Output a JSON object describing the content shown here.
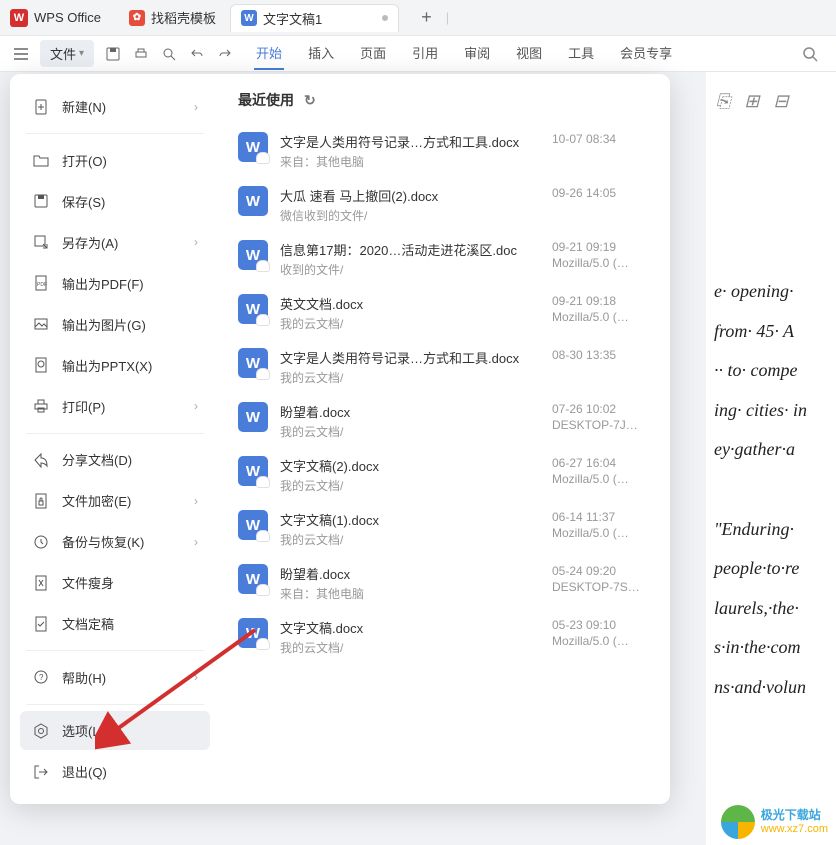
{
  "title_bar": {
    "app_name": "WPS Office",
    "template_tab": "找稻壳模板",
    "doc_tab": "文字文稿1",
    "add": "+",
    "divider": "|"
  },
  "menu_bar": {
    "file_label": "文件",
    "tabs": [
      "开始",
      "插入",
      "页面",
      "引用",
      "审阅",
      "视图",
      "工具",
      "会员专享"
    ],
    "active_index": 0
  },
  "dropdown": {
    "items": [
      {
        "id": "new",
        "label": "新建(N)",
        "arrow": true
      },
      {
        "id": "open",
        "label": "打开(O)",
        "arrow": false
      },
      {
        "id": "save",
        "label": "保存(S)",
        "arrow": false
      },
      {
        "id": "saveas",
        "label": "另存为(A)",
        "arrow": true
      },
      {
        "id": "pdf",
        "label": "输出为PDF(F)",
        "arrow": false
      },
      {
        "id": "image",
        "label": "输出为图片(G)",
        "arrow": false
      },
      {
        "id": "pptx",
        "label": "输出为PPTX(X)",
        "arrow": false
      },
      {
        "id": "print",
        "label": "打印(P)",
        "arrow": true
      },
      {
        "id": "share",
        "label": "分享文档(D)",
        "arrow": false
      },
      {
        "id": "encrypt",
        "label": "文件加密(E)",
        "arrow": true
      },
      {
        "id": "backup",
        "label": "备份与恢复(K)",
        "arrow": true
      },
      {
        "id": "slim",
        "label": "文件瘦身",
        "arrow": false
      },
      {
        "id": "finalize",
        "label": "文档定稿",
        "arrow": false
      },
      {
        "id": "help",
        "label": "帮助(H)",
        "arrow": true
      },
      {
        "id": "options",
        "label": "选项(L)",
        "arrow": false,
        "highlight": true
      },
      {
        "id": "exit",
        "label": "退出(Q)",
        "arrow": false
      }
    ],
    "separators_after": [
      0,
      7,
      12,
      13
    ],
    "recent_header": "最近使用",
    "recent": [
      {
        "name": "文字是人类用符号记录…方式和工具.docx",
        "source": "来自：其他电脑",
        "time": "10-07 08:34",
        "device": "",
        "cloud": true
      },
      {
        "name": "大瓜 速看 马上撤回(2).docx",
        "source": "微信收到的文件/",
        "time": "09-26 14:05",
        "device": "",
        "cloud": false
      },
      {
        "name": "信息第17期：2020…活动走进花溪区.doc",
        "source": "收到的文件/",
        "time": "09-21 09:19",
        "device": "Mozilla/5.0 (…",
        "cloud": true
      },
      {
        "name": "英文文档.docx",
        "source": "我的云文档/",
        "time": "09-21 09:18",
        "device": "Mozilla/5.0 (…",
        "cloud": true
      },
      {
        "name": "文字是人类用符号记录…方式和工具.docx",
        "source": "我的云文档/",
        "time": "08-30 13:35",
        "device": "",
        "cloud": true
      },
      {
        "name": "盼望着.docx",
        "source": "我的云文档/",
        "time": "07-26 10:02",
        "device": "DESKTOP-7J…",
        "cloud": false
      },
      {
        "name": "文字文稿(2).docx",
        "source": "我的云文档/",
        "time": "06-27 16:04",
        "device": "Mozilla/5.0 (…",
        "cloud": true
      },
      {
        "name": "文字文稿(1).docx",
        "source": "我的云文档/",
        "time": "06-14 11:37",
        "device": "Mozilla/5.0 (…",
        "cloud": true
      },
      {
        "name": "盼望着.docx",
        "source": "来自：其他电脑",
        "time": "05-24 09:20",
        "device": "DESKTOP-7S…",
        "cloud": true
      },
      {
        "name": "文字文稿.docx",
        "source": "我的云文档/",
        "time": "05-23 09:10",
        "device": "Mozilla/5.0 (…",
        "cloud": true
      }
    ]
  },
  "document_lines": [
    "e· opening·",
    "from· 45· A",
    "·· to· compe",
    "ing· cities· in",
    "ey·gather·a",
    "",
    "\"Enduring·",
    "people·to·re",
    "laurels,·the·",
    "s·in·the·com",
    "ns·and·volun"
  ],
  "watermark": {
    "line1": "极光下载站",
    "line2": "www.xz7.com"
  },
  "icons_semantic": {
    "new": "file-plus-icon",
    "open": "folder-open-icon",
    "save": "floppy-icon",
    "saveas": "floppy-arrow-icon",
    "pdf": "pdf-export-icon",
    "image": "image-export-icon",
    "pptx": "pptx-export-icon",
    "print": "printer-icon",
    "share": "share-icon",
    "encrypt": "lock-file-icon",
    "backup": "clock-restore-icon",
    "slim": "compress-icon",
    "finalize": "stamp-icon",
    "help": "question-circle-icon",
    "options": "gear-hex-icon",
    "exit": "logout-icon"
  },
  "colors": {
    "accent": "#4a7dda",
    "arrow": "#d32f2f"
  }
}
